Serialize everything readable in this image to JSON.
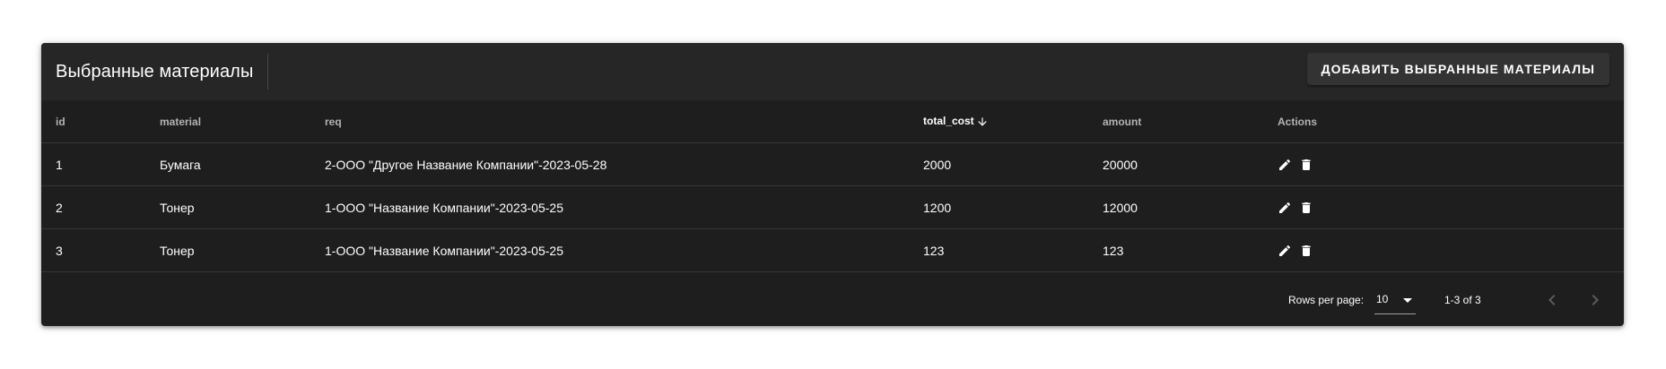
{
  "toolbar": {
    "title": "Выбранные материалы",
    "add_button_label": "ДОБАВИТЬ ВЫБРАННЫЕ МАТЕРИАЛЫ"
  },
  "table": {
    "columns": [
      "id",
      "material",
      "req",
      "total_cost",
      "amount",
      "Actions"
    ],
    "sorted_column": "total_cost",
    "sort_direction": "desc",
    "rows": [
      {
        "id": "1",
        "material": "Бумага",
        "req": "2-ООО \"Другое Название Компании\"-2023-05-28",
        "total_cost": "2000",
        "amount": "20000"
      },
      {
        "id": "2",
        "material": "Тонер",
        "req": "1-ООО \"Название Компании\"-2023-05-25",
        "total_cost": "1200",
        "amount": "12000"
      },
      {
        "id": "3",
        "material": "Тонер",
        "req": "1-ООО \"Название Компании\"-2023-05-25",
        "total_cost": "123",
        "amount": "123"
      }
    ],
    "row_actions": [
      "edit-icon",
      "delete-icon"
    ]
  },
  "pagination": {
    "rows_per_page_label": "Rows per page:",
    "rows_per_page_value": "10",
    "page_info": "1-3 of 3",
    "prev_icon": "chevron-left-icon",
    "next_icon": "chevron-right-icon"
  },
  "colors": {
    "card_background": "#1e1e1e",
    "toolbar_background": "#262626",
    "button_background": "#333333",
    "row_divider": "#363636",
    "disabled_icon": "#5c5c5c"
  }
}
